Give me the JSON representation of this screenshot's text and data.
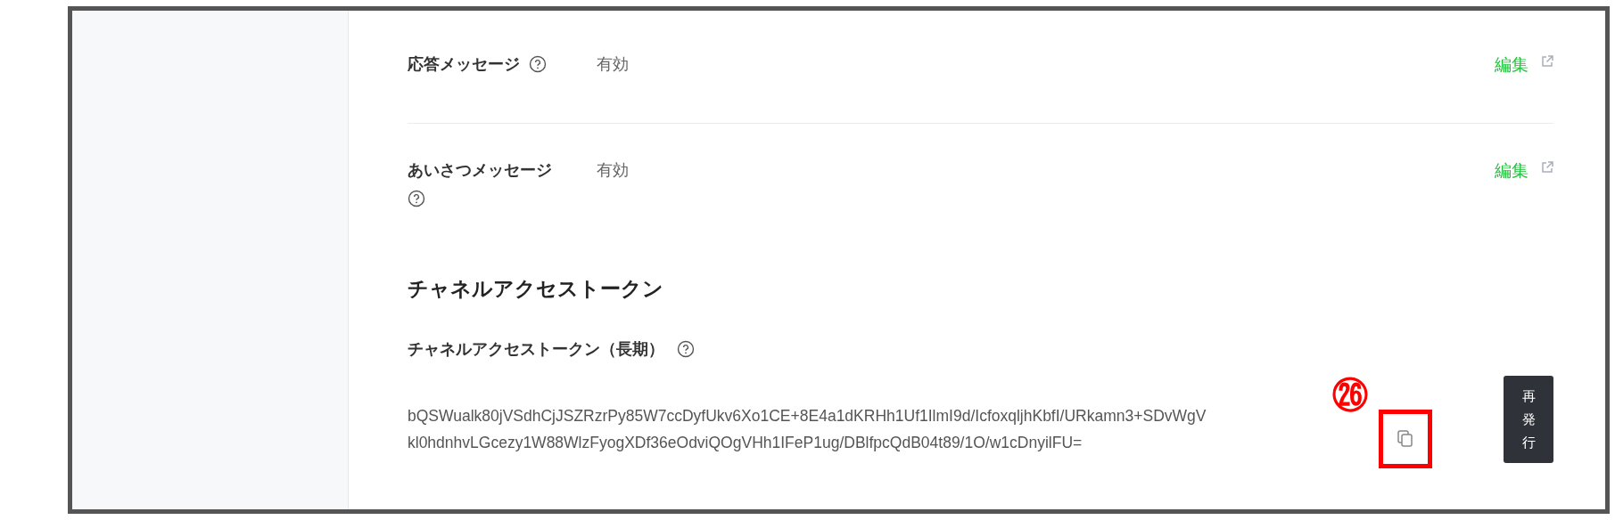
{
  "settings": [
    {
      "label": "応答メッセージ",
      "value": "有効",
      "action": "編集"
    },
    {
      "label": "あいさつメッセージ",
      "value": "有効",
      "action": "編集"
    }
  ],
  "token_section": {
    "title": "チャネルアクセストークン",
    "field_label": "チャネルアクセストークン（長期）",
    "token_lines": [
      "bQSWualk80jVSdhCjJSZRzrPy85W7ccDyfUkv6Xo1CE+8E4a1dKRHh1Uf1IlmI9d/IcfoxqljhKbfI/URkamn3+SDvWgV",
      "kl0hdnhvLGcezy1W88WlzFyogXDf36eOdviQOgVHh1IFeP1ug/DBlfpcQdB04t89/1O/w1cDnyilFU="
    ],
    "reissue_button": "再発行"
  },
  "annotation": {
    "number": "㉖"
  }
}
